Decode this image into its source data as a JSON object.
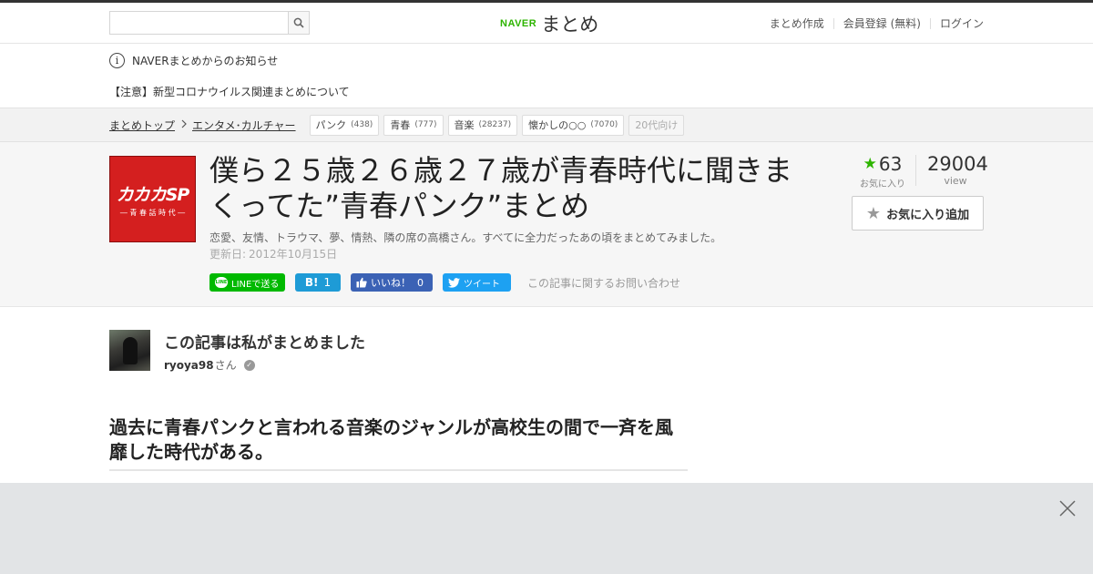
{
  "header": {
    "search_placeholder": "",
    "logo_naver": "NAVER",
    "logo_matome": "まとめ",
    "nav": [
      "まとめ作成",
      "会員登録 (無料)",
      "ログイン"
    ]
  },
  "notice": {
    "title": "NAVERまとめからのお知らせ",
    "link": "【注意】新型コロナウイルス関連まとめについて"
  },
  "breadcrumb": [
    "まとめトップ",
    "エンタメ･カルチャー"
  ],
  "tags": [
    {
      "label": "パンク",
      "count": "(438)"
    },
    {
      "label": "青春",
      "count": "(777)"
    },
    {
      "label": "音楽",
      "count": "(28237)"
    },
    {
      "label": "懐かしの○○",
      "count": "(7070)"
    },
    {
      "label": "20代向け",
      "count": ""
    }
  ],
  "article": {
    "thumb_main": "カカカSP",
    "thumb_sub": "― 青 春 話 時 代 ―",
    "title": "僕ら２５歳２６歳２７歳が青春時代に聞きまくってた”青春パンク”まとめ",
    "description": "恋愛、友情、トラウマ、夢、情熱、隣の席の高橋さん。すべてに全力だったあの頃をまとめてみました。",
    "updated_label": "更新日:",
    "updated_date": "2012年10月15日"
  },
  "stats": {
    "favorites": "63",
    "favorites_label": "お気に入り",
    "views": "29004",
    "views_label": "view",
    "fav_button": "お気に入り追加"
  },
  "share": {
    "line": "LINEで送る",
    "line_icon_text": "LINE",
    "hatena_icon": "B!",
    "hatena_count": "1",
    "fb_label": "いいね！",
    "fb_count": "0",
    "tweet": "ツイート",
    "inquiry": "この記事に関するお問い合わせ"
  },
  "author": {
    "heading": "この記事は私がまとめました",
    "name": "ryoya98",
    "suffix": "さん"
  },
  "section": {
    "title": "過去に青春パンクと言われる音楽のジャンルが高校生の間で一斉を風靡した時代がある。"
  },
  "colors": {
    "naver_green": "#2db400",
    "line_green": "#00b900",
    "facebook": "#3b62b5",
    "twitter": "#1da1f2",
    "hatena": "#1e9bd6",
    "thumb_red": "#d41f1f"
  },
  "icons": {
    "search": "search-icon",
    "info": "info-icon",
    "star": "star-icon",
    "close": "close-icon"
  }
}
